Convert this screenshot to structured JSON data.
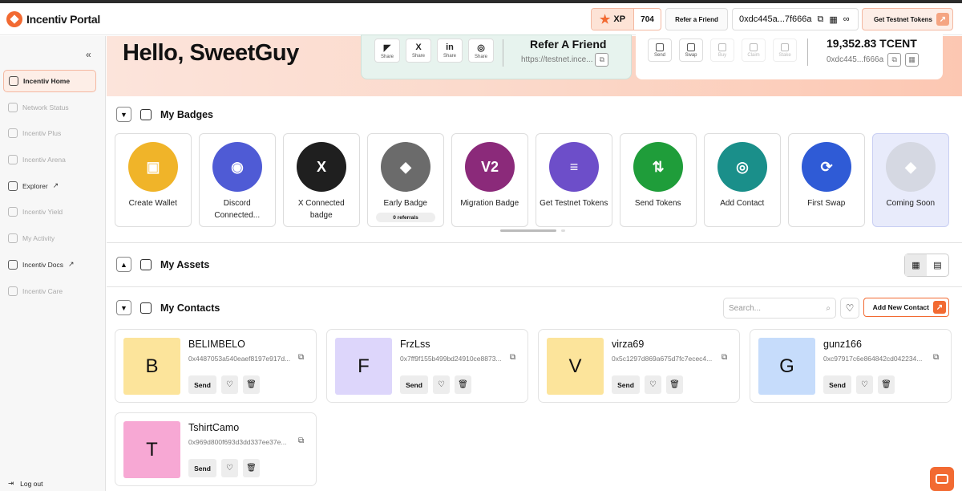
{
  "app": {
    "title": "Incentiv Portal"
  },
  "topbar": {
    "xp_label": "XP",
    "xp_value": "704",
    "refer_button": "Refer a Friend",
    "wallet_address": "0xdc445a...7f666a",
    "testnet_button": "Get Testnet Tokens"
  },
  "sidebar": {
    "items": [
      {
        "label": "Incentiv Home",
        "icon": "home-icon",
        "state": "active"
      },
      {
        "label": "Network Status",
        "icon": "cube-icon",
        "state": "disabled"
      },
      {
        "label": "Incentiv Plus",
        "icon": "plus-circle-icon",
        "state": "disabled"
      },
      {
        "label": "Incentiv Arena",
        "icon": "arena-icon",
        "state": "disabled"
      },
      {
        "label": "Explorer",
        "icon": "eye-icon",
        "state": "normal",
        "external": true
      },
      {
        "label": "Incentiv Yield",
        "icon": "dollar-icon",
        "state": "disabled"
      },
      {
        "label": "My Activity",
        "icon": "activity-icon",
        "state": "disabled"
      },
      {
        "label": "Incentiv Docs",
        "icon": "docs-icon",
        "state": "normal",
        "external": true
      },
      {
        "label": "Incentiv Care",
        "icon": "headset-icon",
        "state": "disabled"
      }
    ],
    "logout_label": "Log out"
  },
  "hero": {
    "greeting": "Hello, SweetGuy",
    "share_buttons": [
      {
        "glyph": "◤",
        "label": "Share",
        "icon": "telegram-icon"
      },
      {
        "glyph": "X",
        "label": "Share",
        "icon": "x-icon"
      },
      {
        "glyph": "in",
        "label": "Share",
        "icon": "linkedin-icon"
      },
      {
        "glyph": "◎",
        "label": "Share",
        "icon": "whatsapp-icon"
      }
    ],
    "refer_title": "Refer A Friend",
    "refer_link": "https://testnet.ince...",
    "wallet_actions": [
      {
        "label": "Send",
        "enabled": true
      },
      {
        "label": "Swap",
        "enabled": true
      },
      {
        "label": "Buy",
        "enabled": false
      },
      {
        "label": "Claim",
        "enabled": false
      },
      {
        "label": "Stake",
        "enabled": false
      }
    ],
    "balance": "19,352.83 TCENT",
    "wallet_short": "0xdc445...f666a"
  },
  "badges_section": {
    "title": "My Badges",
    "badges": [
      {
        "name": "Create Wallet",
        "color": "#f0b429",
        "glyph": "▣"
      },
      {
        "name": "Discord Connected...",
        "color": "#4f5bd5",
        "glyph": "◉"
      },
      {
        "name": "X Connected badge",
        "color": "#1f1f1f",
        "glyph": "X"
      },
      {
        "name": "Early Badge",
        "color": "#6b6b6b",
        "glyph": "◆",
        "pill": "0 referrals"
      },
      {
        "name": "Migration Badge",
        "color": "#8b2a7a",
        "glyph": "V2"
      },
      {
        "name": "Get Testnet Tokens",
        "color": "#6d4ec9",
        "glyph": "≡"
      },
      {
        "name": "Send Tokens",
        "color": "#1f9d3a",
        "glyph": "⇅"
      },
      {
        "name": "Add Contact",
        "color": "#1a8f8a",
        "glyph": "◎"
      },
      {
        "name": "First Swap",
        "color": "#2f5bd6",
        "glyph": "⟳"
      },
      {
        "name": "Coming Soon",
        "color": "#d5d8e2",
        "glyph": "◆",
        "soon": true
      }
    ]
  },
  "assets_section": {
    "title": "My Assets"
  },
  "contacts_section": {
    "title": "My Contacts",
    "search_placeholder": "Search...",
    "add_button": "Add New Contact",
    "send_label": "Send",
    "contacts": [
      {
        "initial": "B",
        "name": "BELIMBELO",
        "address": "0x4487053a540eaef8197e917d...",
        "color": "#fce49b"
      },
      {
        "initial": "F",
        "name": "FrzLss",
        "address": "0x7ff9f155b499bd24910ce8873...",
        "color": "#ddd6fb"
      },
      {
        "initial": "V",
        "name": "virza69",
        "address": "0x5c1297d869a675d7fc7ecec4...",
        "color": "#fce49b"
      },
      {
        "initial": "G",
        "name": "gunz166",
        "address": "0xc97917c6e864842cd042234...",
        "color": "#c6dcfb"
      },
      {
        "initial": "T",
        "name": "TshirtCamo",
        "address": "0x969d800f693d3dd337ee37e...",
        "color": "#f7a8d4"
      }
    ]
  }
}
